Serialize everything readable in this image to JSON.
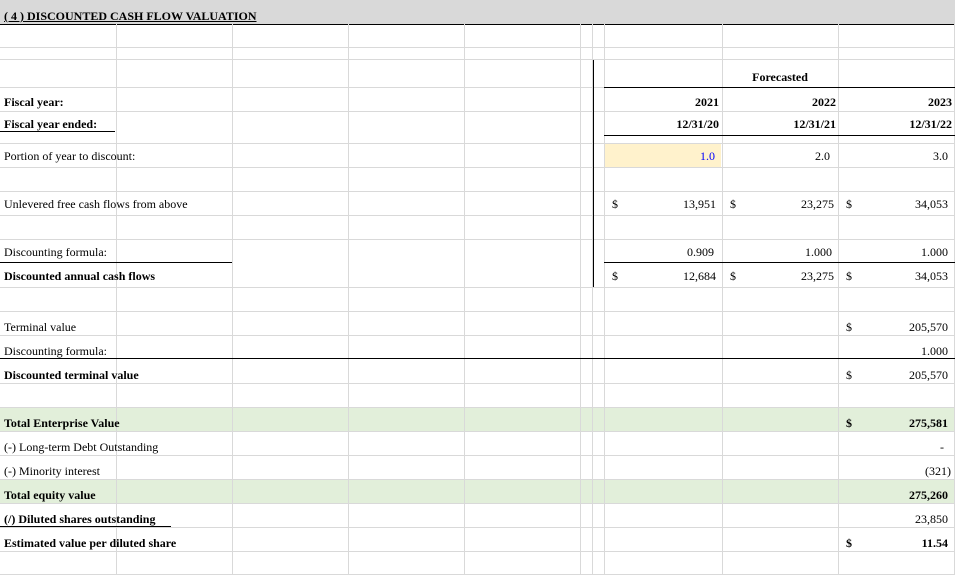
{
  "section_title": "( 4 ) DISCOUNTED CASH FLOW VALUATION",
  "forecast_header": "Forecasted",
  "currency_symbol": "$",
  "columns": [
    {
      "year": "2021",
      "date": "12/31/20"
    },
    {
      "year": "2022",
      "date": "12/31/21"
    },
    {
      "year": "2023",
      "date": "12/31/22"
    }
  ],
  "labels": {
    "fiscal_year": "Fiscal year:",
    "fiscal_year_ended": "Fiscal year ended:",
    "portion_of_year": "Portion of year to discount:",
    "unlevered_fcf": "Unlevered free cash flows from above",
    "discounting_formula": "Discounting formula:",
    "discounted_annual": "Discounted annual cash flows",
    "terminal_value": "Terminal value",
    "tv_discounting_formula": "Discounting formula:",
    "discounted_terminal": "Discounted terminal value",
    "total_ev": "Total Enterprise Value",
    "lt_debt": "(-) Long-term Debt Outstanding",
    "minority": "(-) Minority interest",
    "total_equity": "Total equity value",
    "diluted_shares": "(/) Diluted shares outstanding",
    "value_per_share": "Estimated value per diluted share"
  },
  "rows": {
    "portion_of_year": [
      "1.0",
      "2.0",
      "3.0"
    ],
    "unlevered_fcf": [
      "13,951",
      "23,275",
      "34,053"
    ],
    "discounting_formula": [
      "0.909",
      "1.000",
      "1.000"
    ],
    "discounted_annual": [
      "12,684",
      "23,275",
      "34,053"
    ]
  },
  "terminal": {
    "terminal_value": "205,570",
    "discounting_formula": "1.000",
    "discounted_terminal_value": "205,570"
  },
  "summary": {
    "total_ev": "275,581",
    "lt_debt": "-",
    "minority": "(321)",
    "total_equity": "275,260",
    "diluted_shares": "23,850",
    "value_per_share": "11.54"
  },
  "colors": {
    "title_bar": "#d9d9d9",
    "input_fill": "#fff2cc",
    "highlight_fill": "#e2efda",
    "input_text": "#0000ff",
    "gridline": "#d9d9d9"
  }
}
